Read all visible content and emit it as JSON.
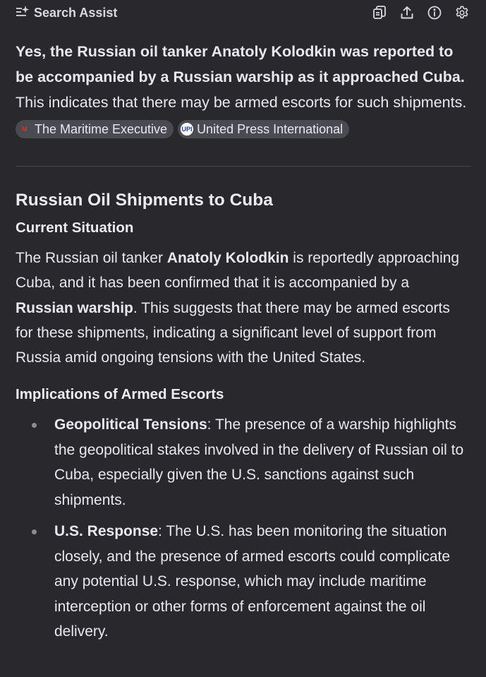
{
  "header": {
    "title": "Search Assist",
    "icons": [
      "copy-icon",
      "share-icon",
      "info-icon",
      "settings-icon"
    ]
  },
  "answer": {
    "bold_text": "Yes, the Russian oil tanker Anatoly Kolodkin was reported to be accompanied by a Russian warship as it approached Cuba.",
    "text": " This indicates that there may be armed escorts for such shipments. ",
    "sources": [
      {
        "name": "The Maritime Executive",
        "logo": "M"
      },
      {
        "name": "United Press International",
        "logo": "UPI"
      }
    ]
  },
  "section": {
    "title": "Russian Oil Shipments to Cuba",
    "current": {
      "heading": "Current Situation",
      "p1": "The Russian oil tanker ",
      "b1": "Anatoly Kolodkin",
      "p2": " is reportedly approaching Cuba, and it has been confirmed that it is accompanied by a ",
      "b2": "Russian warship",
      "p3": ". This suggests that there may be armed escorts for these shipments, indicating a significant level of support from Russia amid ongoing tensions with the United States."
    },
    "implications": {
      "heading": "Implications of Armed Escorts",
      "items": [
        {
          "label": "Geopolitical Tensions",
          "text": ": The presence of a warship highlights the geopolitical stakes involved in the delivery of Russian oil to Cuba, especially given the U.S. sanctions against such shipments."
        },
        {
          "label": "U.S. Response",
          "text": ": The U.S. has been monitoring the situation closely, and the presence of armed escorts could complicate any potential U.S. response, which may include maritime interception or other forms of enforcement against the oil delivery."
        }
      ]
    }
  },
  "colors": {
    "background": "#29282d",
    "text": "#e9e8ee",
    "chip_bg": "#4a4a52",
    "divider": "#4a4950",
    "bullet": "#8c8b93"
  }
}
